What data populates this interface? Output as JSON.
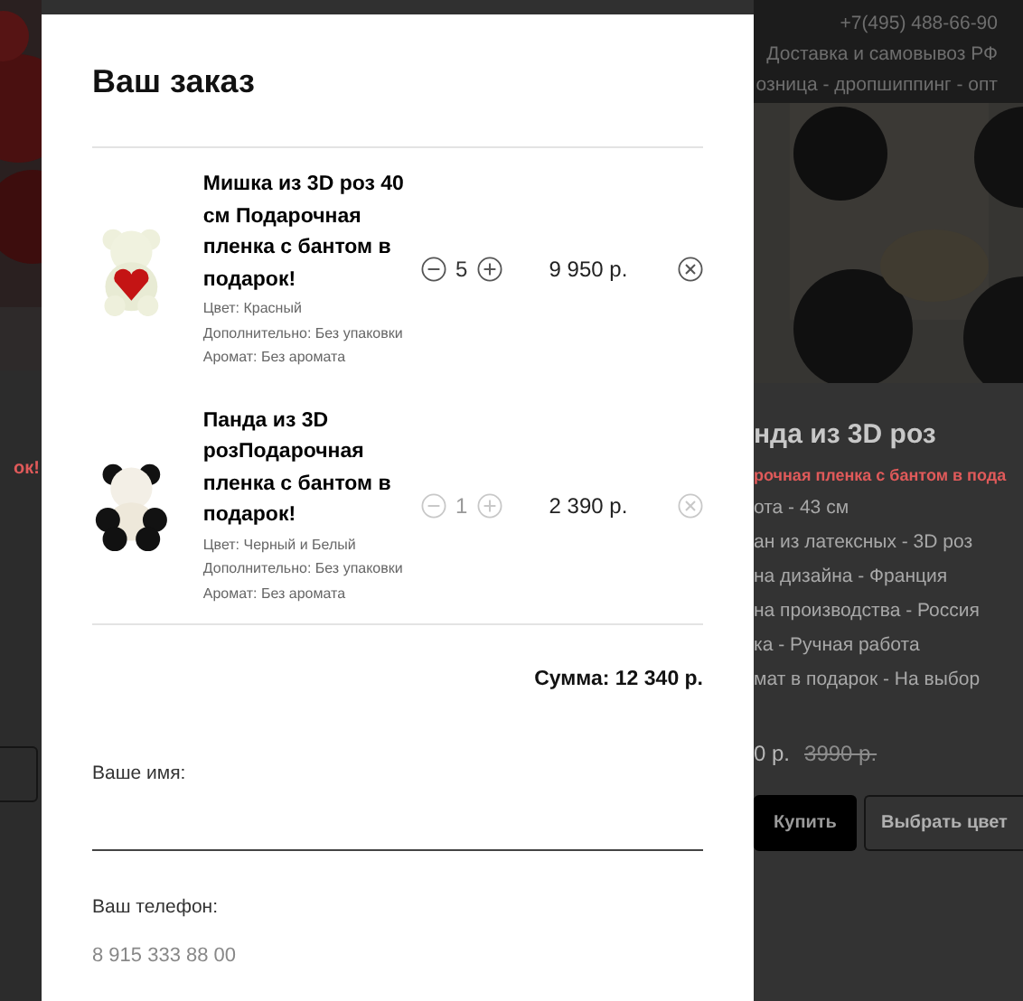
{
  "background_page": {
    "header": {
      "phone": "+7(495) 488-66-90",
      "delivery": "Доставка и самовывоз РФ",
      "sales": "озница - дропшиппинг - опт"
    },
    "left_subtitle": "ок!",
    "product": {
      "title": "нда из 3D роз",
      "subtitle": "рочная пленка с бантом в пода",
      "specs": [
        "ота - 43 см",
        "ан из латексных - 3D роз",
        "на дизайна - Франция",
        "на производства - Россия",
        "ка - Ручная работа",
        "мат в подарок - На выбор"
      ],
      "price": "0 р.",
      "old_price": "3990 р.",
      "buttons": [
        {
          "label": "Купить",
          "kind": "primary"
        },
        {
          "label": "Выбрать цвет",
          "kind": "outline"
        }
      ]
    }
  },
  "modal": {
    "title": "Ваш заказ",
    "items": [
      {
        "name": "Мишка из 3D роз 40 см Подарочная пленка с бантом в подарок!",
        "options": [
          "Цвет: Красный",
          "Дополнительно: Без упаковки",
          "Аромат: Без аромата"
        ],
        "quantity": "5",
        "price": "9 950 р.",
        "disabled": false,
        "kind": "bear"
      },
      {
        "name": "Панда из 3D розПодарочная пленка с бантом в подарок!",
        "options": [
          "Цвет: Черный и Белый",
          "Дополнительно: Без упаковки",
          "Аромат: Без аромата"
        ],
        "quantity": "1",
        "price": "2 390 р.",
        "disabled": true,
        "kind": "panda"
      }
    ],
    "total": "Сумма: 12 340 р.",
    "fields": [
      {
        "label": "Ваше имя:"
      },
      {
        "label": "Ваш телефон:",
        "placeholder": "8 915 333 88 00"
      }
    ]
  }
}
